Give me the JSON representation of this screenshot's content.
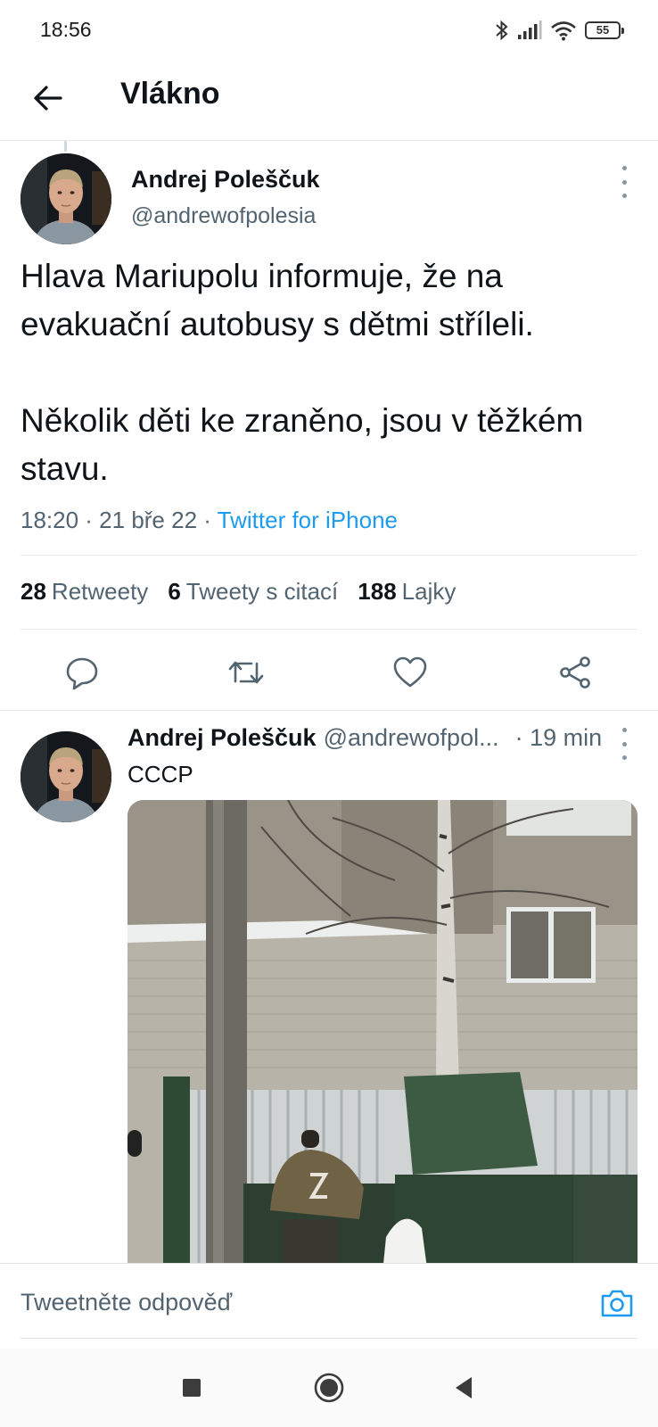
{
  "status_bar": {
    "time": "18:56",
    "battery": "55",
    "icons": [
      "bluetooth-icon",
      "signal-icon",
      "wifi-icon",
      "battery-icon"
    ]
  },
  "header": {
    "title": "Vlákno",
    "back_icon": "arrow-left-icon"
  },
  "main_tweet": {
    "author_name": "Andrej Poleščuk",
    "author_handle": "@andrewofpolesia",
    "paragraph_1": "Hlava Mariupolu informuje, že na evakuační autobusy s dětmi stříleli.",
    "paragraph_2": "Několik děti ke zraněno, jsou v těžkém stavu.",
    "timestamp": "18:20 · 21 bře 22 · ",
    "source": "Twitter for iPhone",
    "stats": {
      "retweets_count": "28",
      "retweets_label": "Retweety",
      "quotes_count": "6",
      "quotes_label": "Tweety s citací",
      "likes_count": "188",
      "likes_label": "Lajky"
    },
    "actions": [
      "reply-icon",
      "retweet-icon",
      "like-icon",
      "share-icon"
    ]
  },
  "reply_tweet": {
    "author_name": "Andrej Poleščuk",
    "author_handle": "@andrewofpol...",
    "time": "· 19 min",
    "text": "СССР",
    "photo": "photo"
  },
  "reply_bar": {
    "placeholder": "Tweetněte odpověď",
    "camera_icon": "camera-icon"
  },
  "nav_bar": {
    "buttons": [
      "recent-apps-icon",
      "home-icon",
      "back-triangle-icon"
    ]
  },
  "colors": {
    "accent": "#1d9bf0",
    "text_primary": "#0f1419",
    "text_secondary": "#536471",
    "divider": "#e6e8ea"
  }
}
